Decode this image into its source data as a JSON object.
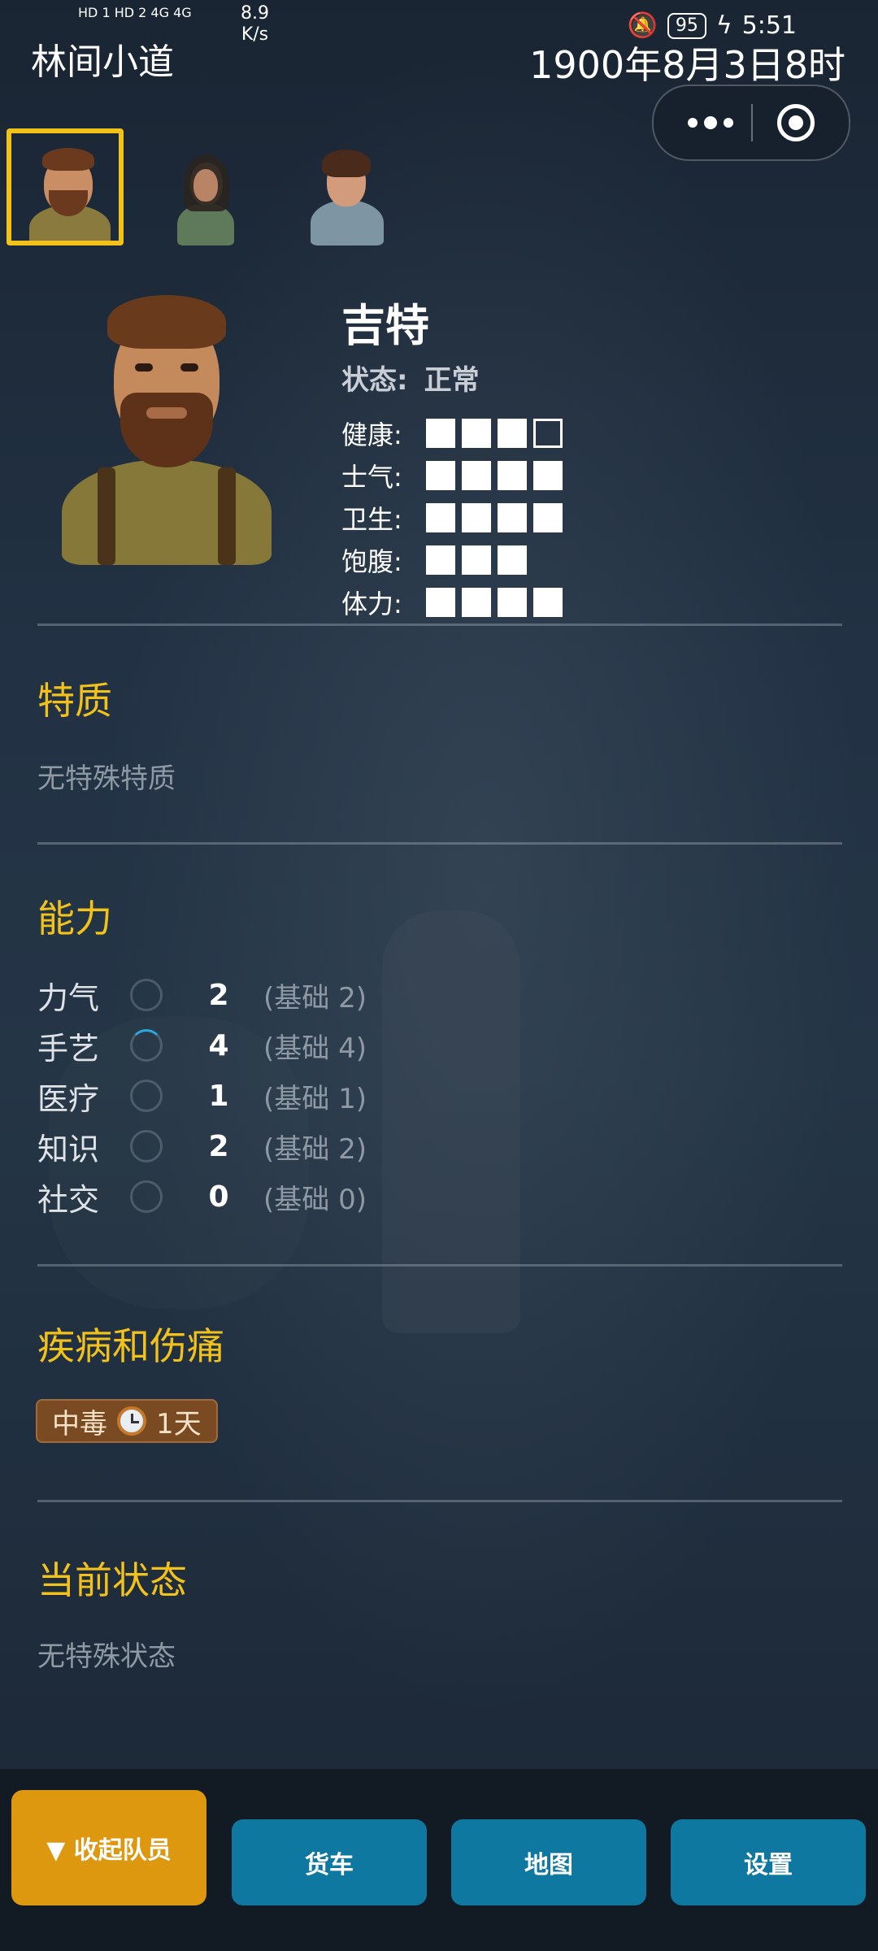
{
  "status_bar": {
    "signal_left": "HD 1 HD 2 4G 4G",
    "net_speed": "8.9",
    "net_unit": "K/s",
    "battery": "95",
    "time": "5:51"
  },
  "header": {
    "location": "林间小道",
    "date": "1900年8月3日8时"
  },
  "team": {
    "portraits": [
      {
        "name": "吉特",
        "selected": true
      },
      {
        "name": "",
        "selected": false
      },
      {
        "name": "",
        "selected": false
      }
    ]
  },
  "character": {
    "name": "吉特",
    "status_label": "状态:",
    "status_value": "正常",
    "stats": [
      {
        "label": "健康:",
        "value": 3,
        "max": 4
      },
      {
        "label": "士气:",
        "value": 4,
        "max": 4
      },
      {
        "label": "卫生:",
        "value": 4,
        "max": 4
      },
      {
        "label": "饱腹:",
        "value": 3,
        "max": 3
      },
      {
        "label": "体力:",
        "value": 4,
        "max": 4
      }
    ]
  },
  "traits": {
    "title": "特质",
    "text": "无特殊特质"
  },
  "abilities": {
    "title": "能力",
    "items": [
      {
        "name": "力气",
        "value": "2",
        "base": "(基础 2)",
        "progress": 0
      },
      {
        "name": "手艺",
        "value": "4",
        "base": "(基础 4)",
        "progress": 0.12
      },
      {
        "name": "医疗",
        "value": "1",
        "base": "(基础 1)",
        "progress": 0
      },
      {
        "name": "知识",
        "value": "2",
        "base": "(基础 2)",
        "progress": 0
      },
      {
        "name": "社交",
        "value": "0",
        "base": "(基础 0)",
        "progress": 0
      }
    ]
  },
  "ailments": {
    "title": "疾病和伤痛",
    "badge_name": "中毒",
    "badge_duration": "1天",
    "badge_icon": "clock-icon"
  },
  "current_status": {
    "title": "当前状态",
    "text": "无特殊状态"
  },
  "bottom_nav": {
    "collapse": "▼ 收起队员",
    "truck": "货车",
    "map": "地图",
    "settings": "设置"
  },
  "colors": {
    "accent_yellow": "#f2c21b",
    "button_orange": "#dd9810",
    "button_blue": "#0f78a0"
  }
}
